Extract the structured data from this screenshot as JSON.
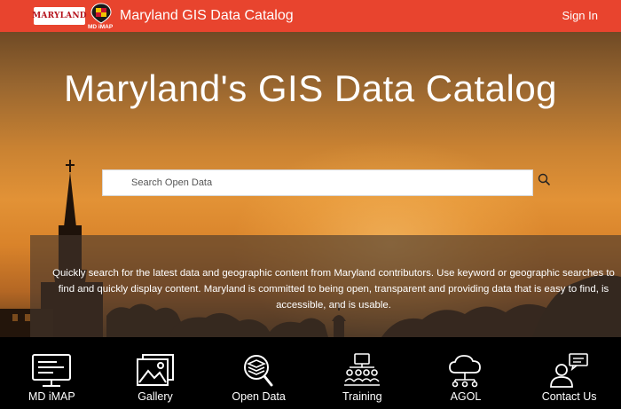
{
  "header": {
    "maryland_logo_text": "MARYLAND",
    "imap_logo_text": "MD iMAP",
    "title": "Maryland GIS Data Catalog",
    "signin_label": "Sign In"
  },
  "hero": {
    "title": "Maryland's GIS Data Catalog",
    "search": {
      "placeholder": "Search Open Data",
      "value": ""
    },
    "description": "Quickly search for the latest data and geographic content from Maryland contributors. Use keyword or geographic searches to find and quickly display content. Maryland is committed to being open, transparent and providing data that is easy to find, is accessible, and is usable."
  },
  "tiles": [
    {
      "label": "MD iMAP",
      "icon": "monitor-icon"
    },
    {
      "label": "Gallery",
      "icon": "photo-gallery-icon"
    },
    {
      "label": "Open Data",
      "icon": "layers-search-icon"
    },
    {
      "label": "Training",
      "icon": "training-icon"
    },
    {
      "label": "AGOL",
      "icon": "cloud-network-icon"
    },
    {
      "label": "Contact Us",
      "icon": "contact-person-icon"
    }
  ],
  "colors": {
    "header_bg": "#e8442e",
    "tile_bar_bg": "#000000",
    "text": "#ffffff"
  }
}
